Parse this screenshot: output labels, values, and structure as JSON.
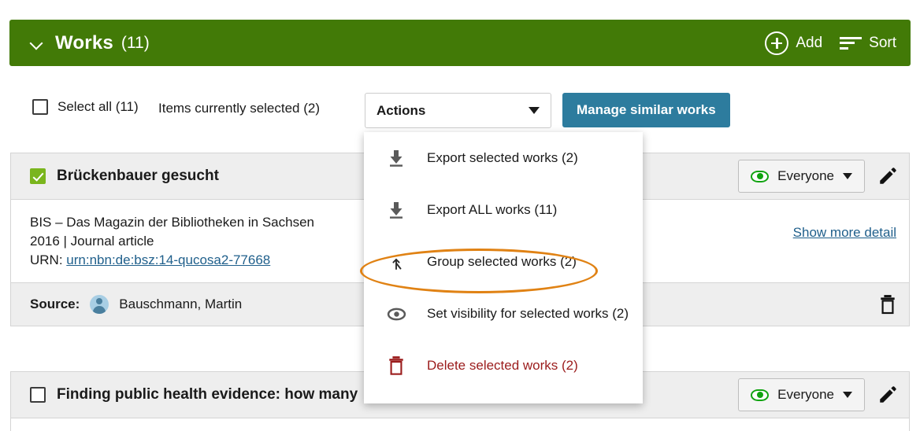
{
  "header": {
    "collapse_icon": "chevron-down-icon",
    "title": "Works",
    "count": "(11)",
    "add_label": "Add",
    "add_icon": "plus-circle-icon",
    "sort_label": "Sort",
    "sort_icon": "sort-lines-icon",
    "background_color": "#427a07"
  },
  "toolbar": {
    "select_all_label": "Select all (11)",
    "select_all_checked": false,
    "items_selected_label": "Items currently selected (2)",
    "actions_label": "Actions",
    "actions_caret_icon": "caret-down-icon",
    "manage_similar_label": "Manage similar works",
    "manage_similar_color": "#2d7c9e"
  },
  "actions_menu": {
    "highlight_color": "#e08214",
    "highlighted_item_index": 2,
    "items": [
      {
        "label": "Export selected works (2)",
        "icon": "download-icon",
        "danger": false
      },
      {
        "label": "Export ALL works (11)",
        "icon": "download-icon",
        "danger": false
      },
      {
        "label": "Group selected works (2)",
        "icon": "merge-arrow-icon",
        "danger": false
      },
      {
        "label": "Set visibility for selected works (2)",
        "icon": "eye-icon",
        "danger": false
      },
      {
        "label": "Delete selected works (2)",
        "icon": "trash-icon",
        "danger": true
      }
    ]
  },
  "works": [
    {
      "title": "Brückenbauer gesucht",
      "selected": true,
      "checkbox_icon": "checkbox-checked-icon",
      "visibility_label": "Everyone",
      "visibility_icon": "eye-icon",
      "edit_icon": "pencil-icon",
      "meta_line_1": "BIS – Das Magazin der Bibliotheken in Sachsen",
      "meta_line_2": "2016 | Journal article",
      "urn_prefix": "URN: ",
      "urn_value": "urn:nbn:de:bsz:14-qucosa2-77668",
      "show_more_label": "Show more detail",
      "source_label": "Source:",
      "source_avatar_icon": "person-avatar-icon",
      "source_name": "Bauschmann, Martin",
      "delete_icon": "trash-icon"
    },
    {
      "title": "Finding public health evidence: how many",
      "selected": false,
      "checkbox_icon": "checkbox-unchecked-icon",
      "visibility_label": "Everyone",
      "visibility_icon": "eye-icon",
      "edit_icon": "pencil-icon"
    }
  ]
}
